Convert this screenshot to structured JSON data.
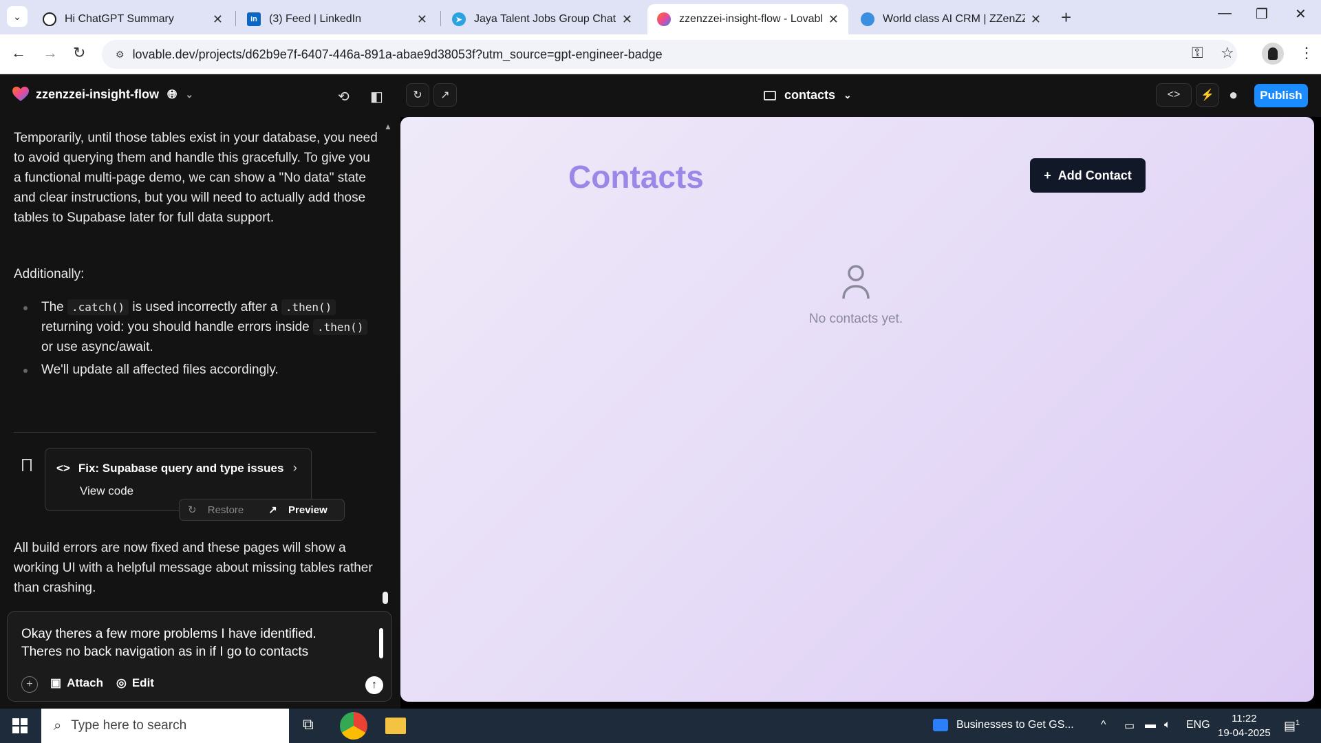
{
  "browser": {
    "tabs": [
      {
        "title": "Hi ChatGPT Summary",
        "active": false
      },
      {
        "title": "(3) Feed | LinkedIn",
        "active": false
      },
      {
        "title": "Jaya Talent Jobs Group Chat",
        "active": false
      },
      {
        "title": "zzenzzei-insight-flow - Lovable",
        "active": true
      },
      {
        "title": "World class AI CRM | ZZenZZei",
        "active": false
      }
    ],
    "url": "lovable.dev/projects/d62b9e7f-6407-446a-891a-abae9d38053f?utm_source=gpt-engineer-badge"
  },
  "app": {
    "project_name": "zzenzzei-insight-flow",
    "route": "contacts",
    "publish_label": "Publish"
  },
  "chat": {
    "para1": "Temporarily, until those tables exist in your database, you need to avoid querying them and handle this gracefully. To give you a functional multi-page demo, we can show a \"No data\" state and clear instructions, but you will need to actually add those tables to Supabase later for full data support.",
    "para2": "Additionally:",
    "bullet1_a": "The",
    "bullet1_code1": ".catch()",
    "bullet1_b": "is used incorrectly after a",
    "bullet1_code2": ".then()",
    "bullet1_c": "returning void: you should handle errors inside",
    "bullet1_code3": ".then()",
    "bullet1_d": "or use async/await.",
    "bullet2": "We'll update all affected files accordingly.",
    "card_title": "Fix: Supabase query and type issues",
    "card_view": "View code",
    "restore_label": "Restore",
    "preview_label": "Preview",
    "para3": "All build errors are now fixed and these pages will show a working UI with a helpful message about missing tables rather than crashing."
  },
  "input": {
    "text_line1": "Okay theres a few more problems I have identified.",
    "text_line2": "Theres no back navigation as in if I go to contacts",
    "attach_label": "Attach",
    "edit_label": "Edit"
  },
  "preview": {
    "title": "Contacts",
    "add_button": "Add Contact",
    "empty_text": "No contacts yet."
  },
  "taskbar": {
    "search_placeholder": "Type here to search",
    "news": "Businesses to Get GS...",
    "lang": "ENG",
    "time": "11:22",
    "date": "19-04-2025",
    "notif_count": "1"
  }
}
